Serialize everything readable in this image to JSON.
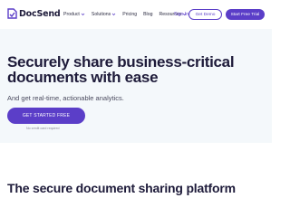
{
  "brand": {
    "name": "DocSend",
    "logo_color": "#5b3ec8"
  },
  "nav": {
    "items": [
      {
        "label": "Product",
        "has_dropdown": true
      },
      {
        "label": "Solutions",
        "has_dropdown": true
      },
      {
        "label": "Pricing",
        "has_dropdown": false
      },
      {
        "label": "Blog",
        "has_dropdown": false
      },
      {
        "label": "Resources",
        "has_dropdown": true
      }
    ],
    "sign_in": "Sign In",
    "get_demo": "Get Demo",
    "free_trial": "Start Free Trial"
  },
  "hero": {
    "headline": "Securely share business-critical documents with ease",
    "subheadline": "And get real-time, actionable analytics.",
    "cta_label": "GET STARTED FREE",
    "note": "No credit card required",
    "background": "#f4f8fb"
  },
  "section": {
    "title": "The secure document sharing platform"
  },
  "colors": {
    "accent": "#5b3ec8",
    "text_dark": "#1e1b3a"
  },
  "icons": {
    "logo": "docsend-logo-icon",
    "dropdown": "chevron-down-icon"
  }
}
